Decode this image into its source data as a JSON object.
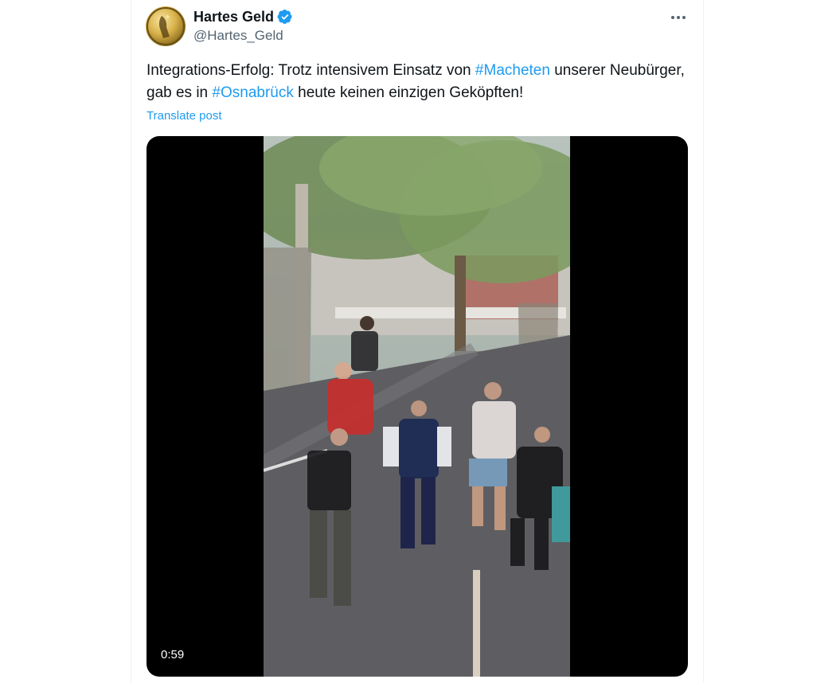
{
  "author": {
    "display_name": "Hartes Geld",
    "handle": "@Hartes_Geld",
    "verified_icon": "verified-badge-icon",
    "avatar_icon": "gold-coin-avatar"
  },
  "post": {
    "text_part1": "Integrations-Erfolg: Trotz intensivem Einsatz von ",
    "hashtag1": "#Macheten",
    "text_part2": " unserer Neubürger, gab es in ",
    "hashtag2": "#Osnabrück",
    "text_part3": " heute keinen einzigen Geköpften!",
    "translate_label": "Translate post"
  },
  "media": {
    "duration": "0:59"
  },
  "colors": {
    "link": "#1d9bf0",
    "text": "#0f1419",
    "secondary": "#536471"
  }
}
